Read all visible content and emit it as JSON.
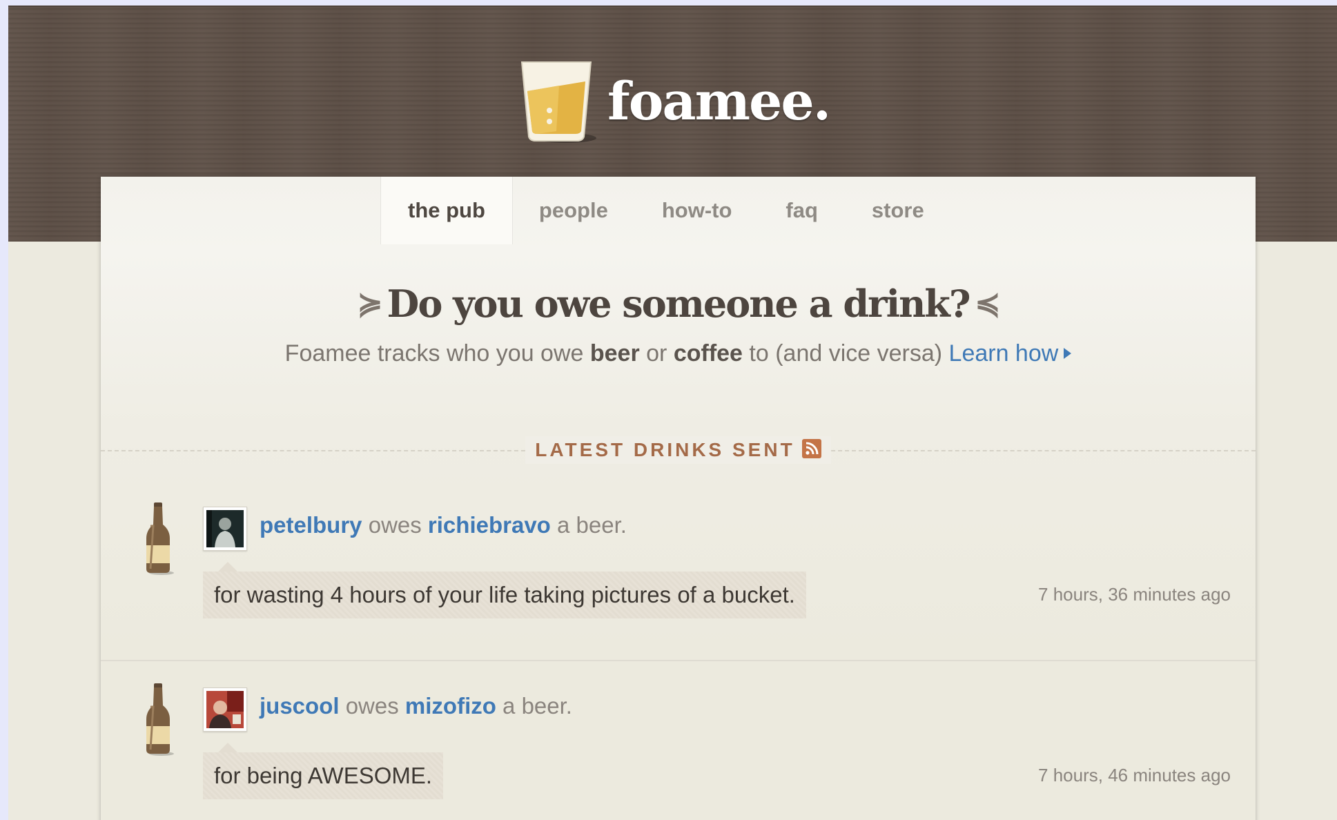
{
  "brand": {
    "name": "foamee."
  },
  "nav": {
    "tabs": [
      {
        "label": "the pub",
        "active": true
      },
      {
        "label": "people",
        "active": false
      },
      {
        "label": "how-to",
        "active": false
      },
      {
        "label": "faq",
        "active": false
      },
      {
        "label": "store",
        "active": false
      }
    ]
  },
  "hero": {
    "headline": "Do you owe someone a drink?",
    "tagline_part1": "Foamee tracks who you owe ",
    "tagline_beer": "beer",
    "tagline_part2": " or ",
    "tagline_coffee": "coffee",
    "tagline_part3": " to (and vice versa) ",
    "learn_how": "Learn how"
  },
  "feed": {
    "title": "LATEST DRINKS SENT",
    "items": [
      {
        "from": "petelbury",
        "owes": " owes ",
        "to": "richiebravo",
        "suffix": " a beer.",
        "reason": "for wasting 4 hours of your life taking pictures of a bucket.",
        "time": "7 hours, 36 minutes ago"
      },
      {
        "from": "juscool",
        "owes": " owes ",
        "to": "mizofizo",
        "suffix": " a beer.",
        "reason": "for being AWESOME.",
        "time": "7 hours, 46 minutes ago"
      }
    ]
  },
  "colors": {
    "wood": "#5f5148",
    "link": "#3f79b6",
    "accent": "#a46a48",
    "beer": "#e8b94a"
  },
  "icons": [
    "beer-glass-logo-icon",
    "swirl-left-icon",
    "swirl-right-icon",
    "play-arrow-icon",
    "rss-icon",
    "beer-bottle-icon"
  ]
}
